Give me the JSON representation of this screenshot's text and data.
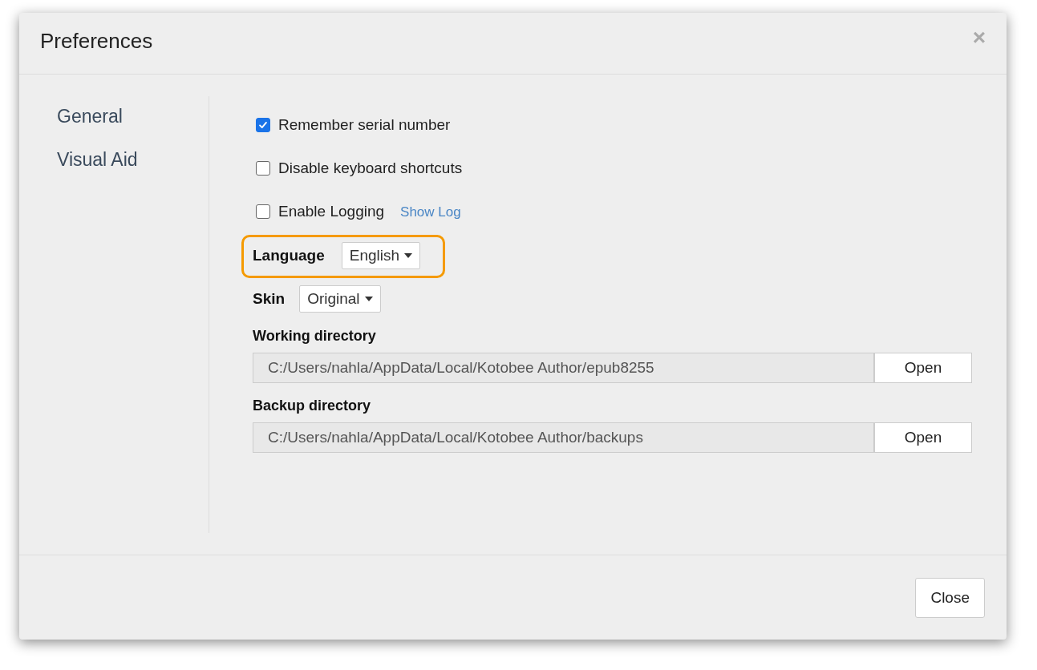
{
  "dialog": {
    "title": "Preferences",
    "close_glyph": "×"
  },
  "sidebar": {
    "items": [
      {
        "label": "General"
      },
      {
        "label": "Visual Aid"
      }
    ]
  },
  "options": [
    {
      "kind": "checkbox",
      "label": "Remember serial number",
      "checked": true
    },
    {
      "kind": "checkbox",
      "label": "Disable keyboard shortcuts",
      "checked": false
    },
    {
      "kind": "checkbox",
      "label": "Enable Logging",
      "checked": false,
      "link": "Show Log"
    }
  ],
  "selects": [
    {
      "label": "Language",
      "value": "English",
      "highlighted": true
    },
    {
      "label": "Skin",
      "value": "Original",
      "highlighted": false
    }
  ],
  "directories": [
    {
      "label": "Working directory",
      "value": "C:/Users/nahla/AppData/Local/Kotobee Author/epub8255",
      "button": "Open"
    },
    {
      "label": "Backup directory",
      "value": "C:/Users/nahla/AppData/Local/Kotobee Author/backups",
      "button": "Open"
    }
  ],
  "footer": {
    "button": "Close"
  }
}
